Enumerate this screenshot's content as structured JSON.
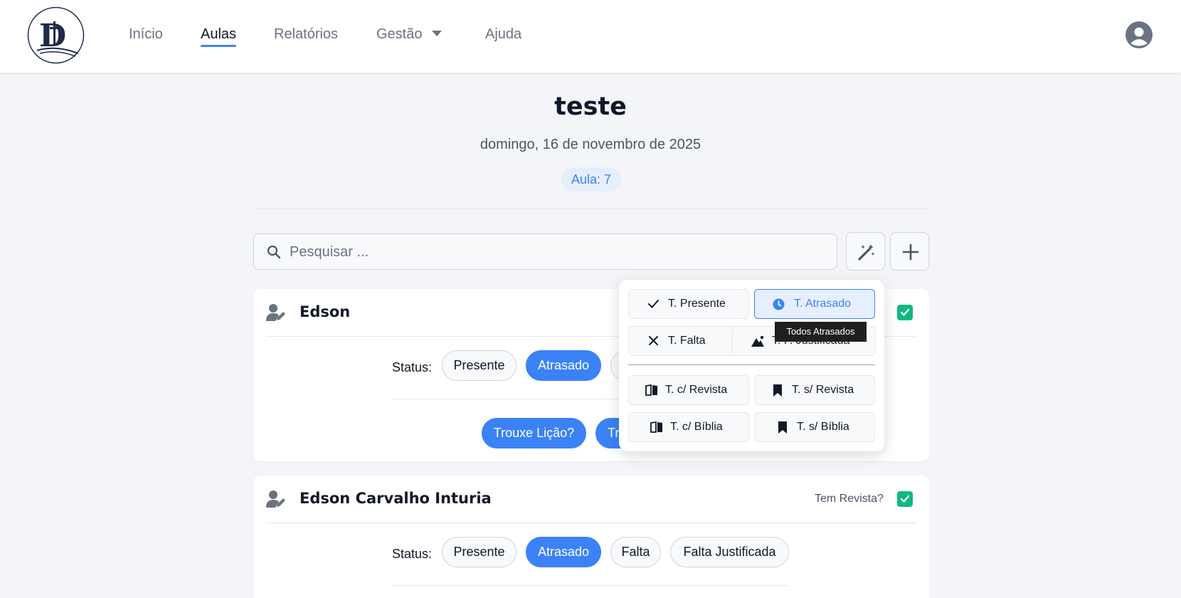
{
  "nav": {
    "items": [
      "Início",
      "Aulas",
      "Relatórios",
      "Gestão",
      "Ajuda"
    ],
    "active": "Aulas",
    "accent": "#3b82f6"
  },
  "header": {
    "title": "teste",
    "date": "domingo, 16 de novembro de 2025",
    "aula_badge": "Aula: 7"
  },
  "search": {
    "placeholder": "Pesquisar ..."
  },
  "students": [
    {
      "name": "Edson",
      "status_label": "Status:",
      "status_options": [
        "Presente",
        "Atrasado"
      ],
      "selected_status": "Atrasado",
      "extra_buttons": [
        "Trouxe Lição?",
        "Tr"
      ]
    },
    {
      "name": "Edson Carvalho Inturia",
      "tem_revista_label": "Tem Revista?",
      "tem_revista_checked": true,
      "status_label": "Status:",
      "status_options": [
        "Presente",
        "Atrasado",
        "Falta",
        "Falta Justificada"
      ],
      "selected_status": "Atrasado"
    }
  ],
  "bulk_menu": {
    "items": [
      {
        "label": "T. Presente",
        "icon": "check-icon"
      },
      {
        "label": "T. Atrasado",
        "icon": "clock-icon",
        "active": true
      },
      {
        "label": "T. Falta",
        "icon": "x-icon"
      },
      {
        "label": "T. F. Justificada",
        "icon": "mountain-icon"
      },
      {
        "label": "T. c/ Revista",
        "icon": "book-open-icon"
      },
      {
        "label": "T. s/ Revista",
        "icon": "bookmark-icon"
      },
      {
        "label": "T. c/ Bíblia",
        "icon": "book-open-icon"
      },
      {
        "label": "T. s/ Bíblia",
        "icon": "bookmark-icon"
      }
    ],
    "tooltip": "Todos Atrasados"
  },
  "colors": {
    "success": "#10b981",
    "primary": "#3b82f6"
  }
}
